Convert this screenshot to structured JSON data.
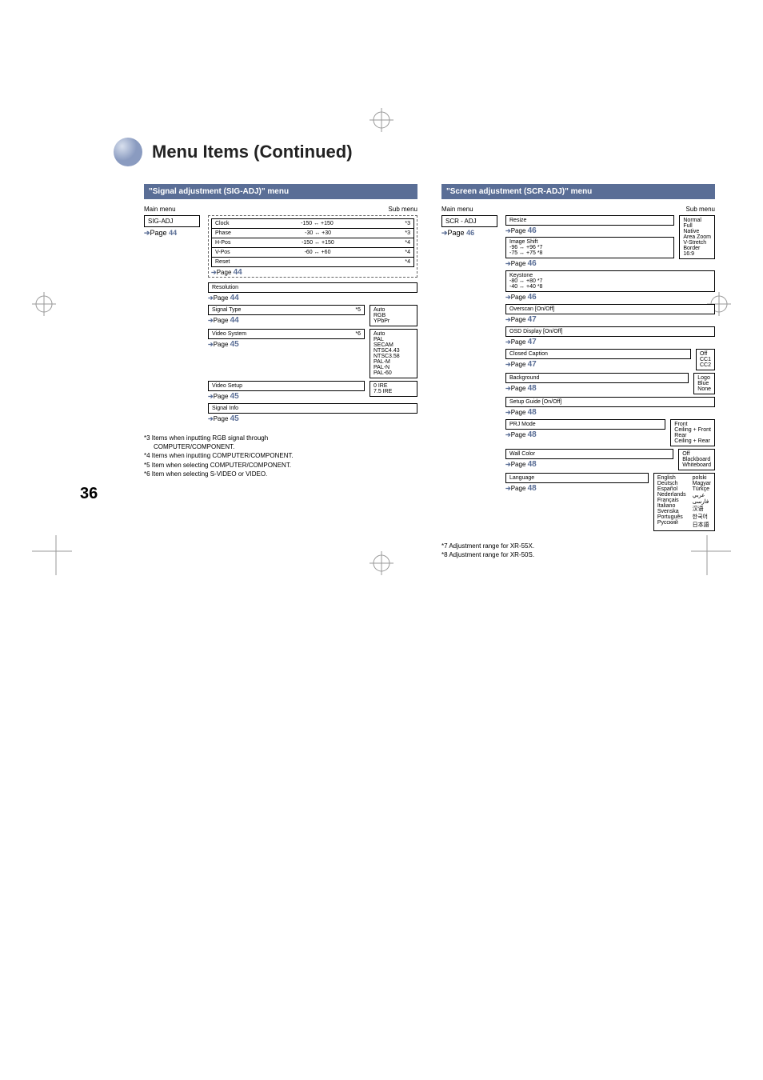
{
  "title": "Menu Items (Continued)",
  "page_number": "36",
  "sig_adj": {
    "header": "\"Signal adjustment (SIG-ADJ)\" menu",
    "main_label": "Main menu",
    "sub_label": "Sub menu",
    "main_box": "SIG-ADJ",
    "main_ref": "44",
    "items": {
      "clock": {
        "label": "Clock",
        "range": "-150 ↔ +150",
        "mark": "*3"
      },
      "phase": {
        "label": "Phase",
        "range": "-30 ↔ +30",
        "mark": "*3"
      },
      "hpos": {
        "label": "H-Pos",
        "range": "-150 ↔ +150",
        "mark": "*4"
      },
      "vpos": {
        "label": "V-Pos",
        "range": "-60 ↔ +60",
        "mark": "*4"
      },
      "reset": {
        "label": "Reset",
        "mark": "*4",
        "ref": "44"
      },
      "resolution": {
        "label": "Resolution",
        "ref": "44"
      },
      "signal_type": {
        "label": "Signal Type",
        "mark": "*5",
        "ref": "44",
        "opts": "Auto\nRGB\nYPbPr"
      },
      "video_system": {
        "label": "Video System",
        "mark": "*6",
        "ref": "45",
        "opts": "Auto\nPAL\nSECAM\nNTSC4.43\nNTSC3.58\nPAL-M\nPAL-N\nPAL-60"
      },
      "video_setup": {
        "label": "Video Setup",
        "ref": "45",
        "opts": "0 IRE\n7.5 IRE"
      },
      "signal_info": {
        "label": "Signal Info",
        "ref": "45"
      }
    },
    "footnotes": {
      "n3a": "*3 Items when inputting RGB signal through",
      "n3b": "COMPUTER/COMPONENT.",
      "n4": "*4 Items when inputting COMPUTER/COMPONENT.",
      "n5": "*5 Item when selecting COMPUTER/COMPONENT.",
      "n6": "*6 Item when selecting S-VIDEO or VIDEO."
    }
  },
  "scr_adj": {
    "header": "\"Screen adjustment (SCR-ADJ)\" menu",
    "main_label": "Main menu",
    "sub_label": "Sub menu",
    "main_box": "SCR - ADJ",
    "main_ref": "46",
    "items": {
      "resize": {
        "label": "Resize",
        "ref": "46",
        "opts": "Normal\nFull\nNative\nArea Zoom\nV-Stretch\nBorder\n16:9"
      },
      "image_shift": {
        "label": "Image Shift",
        "line1": "-96 ↔ +96 *7",
        "line2": "-75 ↔ +75 *8",
        "ref": "46"
      },
      "keystone": {
        "label": "Keystone",
        "line1": "-80 ↔ +80 *7",
        "line2": "-40 ↔ +40 *8",
        "ref": "46"
      },
      "overscan": {
        "label": "Overscan [On/Off]",
        "ref": "47"
      },
      "osd": {
        "label": "OSD Display [On/Off]",
        "ref": "47"
      },
      "closed_caption": {
        "label": "Closed Caption",
        "ref": "47",
        "opts": "Off\nCC1\nCC2"
      },
      "background": {
        "label": "Background",
        "ref": "48",
        "opts": "Logo\nBlue\nNone"
      },
      "setup_guide": {
        "label": "Setup Guide [On/Off]",
        "ref": "48"
      },
      "prj_mode": {
        "label": "PRJ Mode",
        "ref": "48",
        "opts": "Front\nCeiling + Front\nRear\nCeiling + Rear"
      },
      "wall_color": {
        "label": "Wall Color",
        "ref": "48",
        "opts": "Off\nBlackboard\nWhiteboard"
      },
      "language": {
        "label": "Language",
        "ref": "48",
        "col1": "English\nDeutsch\nEspañol\nNederlands\nFrançais\nItaliano\nSvenska\nPortuguês\nРусский",
        "col2": "polski\nMagyar\nTürkçe\nعربي\nفارسی\n汉语\n한국어\n日本語"
      }
    },
    "footnotes": {
      "n7": "*7 Adjustment range for XR-55X.",
      "n8": "*8 Adjustment range for XR-50S."
    }
  },
  "ref_prefix": "Page"
}
